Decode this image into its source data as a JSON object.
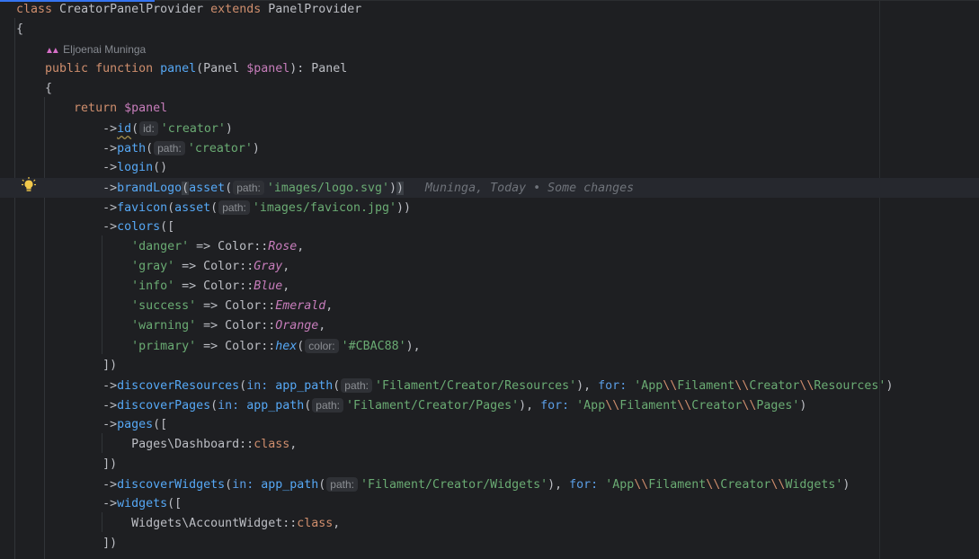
{
  "editor": {
    "author_hint": "Eljoenai Muninga",
    "blame": "Muninga, Today • Some changes",
    "highlighted_line": 9,
    "lines": [
      [
        [
          "kw",
          "class "
        ],
        [
          "p",
          "CreatorPanelProvider "
        ],
        [
          "kw",
          "extends "
        ],
        [
          "p",
          "PanelProvider"
        ]
      ],
      [
        [
          "p",
          "{"
        ]
      ],
      [
        [
          "author",
          "Eljoenai Muninga"
        ]
      ],
      [
        [
          "p",
          "    "
        ],
        [
          "kw",
          "public function "
        ],
        [
          "fn",
          "panel"
        ],
        [
          "p",
          "(Panel "
        ],
        [
          "var",
          "$panel"
        ],
        [
          "p",
          "): Panel"
        ]
      ],
      [
        [
          "p",
          "    {"
        ]
      ],
      [
        [
          "p",
          "        "
        ],
        [
          "kw",
          "return "
        ],
        [
          "var",
          "$panel"
        ]
      ],
      [
        [
          "p",
          "            ->"
        ],
        [
          "ul",
          "id"
        ],
        [
          "p",
          "("
        ],
        [
          "hint",
          "id:"
        ],
        [
          "str",
          "'creator'"
        ],
        [
          "p",
          ")"
        ]
      ],
      [
        [
          "p",
          "            ->"
        ],
        [
          "fn",
          "path"
        ],
        [
          "p",
          "("
        ],
        [
          "hint",
          "path:"
        ],
        [
          "str",
          "'creator'"
        ],
        [
          "p",
          ")"
        ]
      ],
      [
        [
          "p",
          "            ->"
        ],
        [
          "fn",
          "login"
        ],
        [
          "p",
          "()"
        ]
      ],
      [
        [
          "p",
          "            ->"
        ],
        [
          "fn",
          "brandLogo"
        ],
        [
          "brk",
          "("
        ],
        [
          "fn",
          "asset"
        ],
        [
          "p",
          "("
        ],
        [
          "hint",
          "path:"
        ],
        [
          "str",
          "'images/logo.svg'"
        ],
        [
          "p",
          ")"
        ],
        [
          "brk",
          ")"
        ],
        [
          "blame",
          "Muninga, Today • Some changes"
        ]
      ],
      [
        [
          "p",
          "            ->"
        ],
        [
          "fn",
          "favicon"
        ],
        [
          "p",
          "("
        ],
        [
          "fn",
          "asset"
        ],
        [
          "p",
          "("
        ],
        [
          "hint",
          "path:"
        ],
        [
          "str",
          "'images/favicon.jpg'"
        ],
        [
          "p",
          "))"
        ]
      ],
      [
        [
          "p",
          "            ->"
        ],
        [
          "fn",
          "colors"
        ],
        [
          "p",
          "(["
        ]
      ],
      [
        [
          "p",
          "                "
        ],
        [
          "str",
          "'danger'"
        ],
        [
          "p",
          " => Color::"
        ],
        [
          "en",
          "Rose"
        ],
        [
          "p",
          ","
        ]
      ],
      [
        [
          "p",
          "                "
        ],
        [
          "str",
          "'gray'"
        ],
        [
          "p",
          " => Color::"
        ],
        [
          "en",
          "Gray"
        ],
        [
          "p",
          ","
        ]
      ],
      [
        [
          "p",
          "                "
        ],
        [
          "str",
          "'info'"
        ],
        [
          "p",
          " => Color::"
        ],
        [
          "en",
          "Blue"
        ],
        [
          "p",
          ","
        ]
      ],
      [
        [
          "p",
          "                "
        ],
        [
          "str",
          "'success'"
        ],
        [
          "p",
          " => Color::"
        ],
        [
          "en",
          "Emerald"
        ],
        [
          "p",
          ","
        ]
      ],
      [
        [
          "p",
          "                "
        ],
        [
          "str",
          "'warning'"
        ],
        [
          "p",
          " => Color::"
        ],
        [
          "en",
          "Orange"
        ],
        [
          "p",
          ","
        ]
      ],
      [
        [
          "p",
          "                "
        ],
        [
          "str",
          "'primary'"
        ],
        [
          "p",
          " => Color::"
        ],
        [
          "sfn",
          "hex"
        ],
        [
          "p",
          "("
        ],
        [
          "hint",
          "color:"
        ],
        [
          "str",
          "'#CBAC88'"
        ],
        [
          "p",
          "),"
        ]
      ],
      [
        [
          "p",
          "            ])"
        ]
      ],
      [
        [
          "p",
          "            ->"
        ],
        [
          "fn",
          "discoverResources"
        ],
        [
          "p",
          "("
        ],
        [
          "nm",
          "in: "
        ],
        [
          "fn",
          "app_path"
        ],
        [
          "p",
          "("
        ],
        [
          "hint",
          "path:"
        ],
        [
          "str",
          "'Filament/Creator/Resources'"
        ],
        [
          "p",
          "), "
        ],
        [
          "nm",
          "for: "
        ],
        [
          "str",
          "'App"
        ],
        [
          "esc",
          "\\\\"
        ],
        [
          "str",
          "Filament"
        ],
        [
          "esc",
          "\\\\"
        ],
        [
          "str",
          "Creator"
        ],
        [
          "esc",
          "\\\\"
        ],
        [
          "str",
          "Resources'"
        ],
        [
          "p",
          ")"
        ]
      ],
      [
        [
          "p",
          "            ->"
        ],
        [
          "fn",
          "discoverPages"
        ],
        [
          "p",
          "("
        ],
        [
          "nm",
          "in: "
        ],
        [
          "fn",
          "app_path"
        ],
        [
          "p",
          "("
        ],
        [
          "hint",
          "path:"
        ],
        [
          "str",
          "'Filament/Creator/Pages'"
        ],
        [
          "p",
          "), "
        ],
        [
          "nm",
          "for: "
        ],
        [
          "str",
          "'App"
        ],
        [
          "esc",
          "\\\\"
        ],
        [
          "str",
          "Filament"
        ],
        [
          "esc",
          "\\\\"
        ],
        [
          "str",
          "Creator"
        ],
        [
          "esc",
          "\\\\"
        ],
        [
          "str",
          "Pages'"
        ],
        [
          "p",
          ")"
        ]
      ],
      [
        [
          "p",
          "            ->"
        ],
        [
          "fn",
          "pages"
        ],
        [
          "p",
          "(["
        ]
      ],
      [
        [
          "p",
          "                Pages\\Dashboard::"
        ],
        [
          "kw",
          "class"
        ],
        [
          "p",
          ","
        ]
      ],
      [
        [
          "p",
          "            ])"
        ]
      ],
      [
        [
          "p",
          "            ->"
        ],
        [
          "fn",
          "discoverWidgets"
        ],
        [
          "p",
          "("
        ],
        [
          "nm",
          "in: "
        ],
        [
          "fn",
          "app_path"
        ],
        [
          "p",
          "("
        ],
        [
          "hint",
          "path:"
        ],
        [
          "str",
          "'Filament/Creator/Widgets'"
        ],
        [
          "p",
          "), "
        ],
        [
          "nm",
          "for: "
        ],
        [
          "str",
          "'App"
        ],
        [
          "esc",
          "\\\\"
        ],
        [
          "str",
          "Filament"
        ],
        [
          "esc",
          "\\\\"
        ],
        [
          "str",
          "Creator"
        ],
        [
          "esc",
          "\\\\"
        ],
        [
          "str",
          "Widgets'"
        ],
        [
          "p",
          ")"
        ]
      ],
      [
        [
          "p",
          "            ->"
        ],
        [
          "fn",
          "widgets"
        ],
        [
          "p",
          "(["
        ]
      ],
      [
        [
          "p",
          "                Widgets\\AccountWidget::"
        ],
        [
          "kw",
          "class"
        ],
        [
          "p",
          ","
        ]
      ],
      [
        [
          "p",
          "            ])"
        ]
      ]
    ]
  }
}
